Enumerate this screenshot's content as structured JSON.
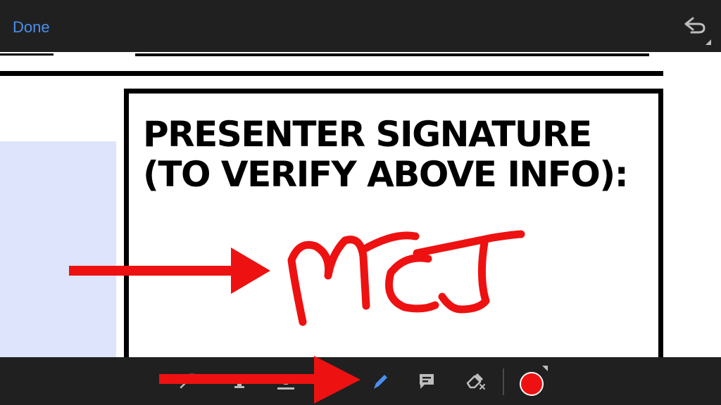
{
  "topbar": {
    "done_label": "Done",
    "undo_icon": "undo-icon"
  },
  "document": {
    "heading_line1": "PRESENTER SIGNATURE",
    "heading_line2": "(TO VERIFY ABOVE INFO):"
  },
  "toolbar": {
    "tools": [
      {
        "name": "lasso-select-tool",
        "icon": "lasso-icon",
        "active": false
      },
      {
        "name": "text-highlight-tool",
        "icon": "highlight-icon",
        "active": false
      },
      {
        "name": "text-underline-tool",
        "icon": "underline-icon",
        "active": false
      },
      {
        "name": "pen-tool",
        "icon": "pen-icon",
        "active": true
      },
      {
        "name": "comment-tool",
        "icon": "comment-icon",
        "active": false
      },
      {
        "name": "eraser-tool",
        "icon": "eraser-icon",
        "active": false
      }
    ],
    "selected_color": "#ee1111"
  },
  "colors": {
    "accent": "#4a8ff0",
    "bar_background": "#202020",
    "ink": "#ee1111",
    "field_highlight": "#dde4fb",
    "icon_gray": "#bdbdbd"
  }
}
